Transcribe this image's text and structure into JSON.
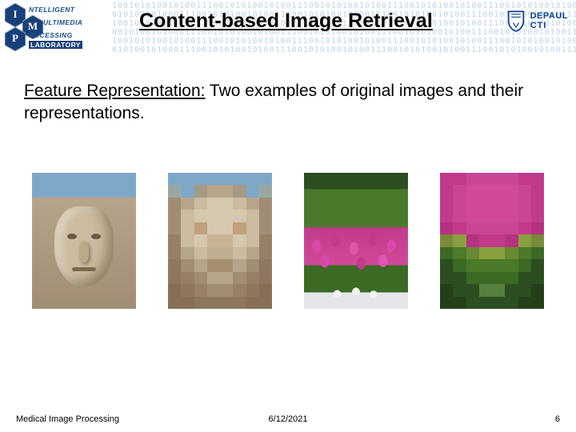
{
  "header": {
    "title": "Content-based Image Retrieval",
    "lab_logo": {
      "letters": [
        "I",
        "M",
        "P"
      ],
      "words": [
        "NTELLIGENT",
        "ULTIMEDIA",
        "ROCESSING"
      ],
      "suffix": "LABORATORY"
    },
    "depaul": {
      "line1": "DEPAUL",
      "line2": "CTI"
    }
  },
  "body": {
    "lead": "Feature Representation:",
    "rest": " Two examples of original images and their representations."
  },
  "images": {
    "items": [
      {
        "caption": ""
      },
      {
        "caption": ""
      },
      {
        "caption": ""
      },
      {
        "caption": ""
      }
    ]
  },
  "footer": {
    "left": "Medical Image Processing",
    "date": "6/12/2021",
    "page": "6"
  },
  "pixels": {
    "repr1": [
      "#7ea8c9",
      "#7ea8c9",
      "#7ea8c9",
      "#7ea8c9",
      "#7ea8c9",
      "#7ea8c9",
      "#7ea8c9",
      "#7ea8c9",
      "#9aa7a0",
      "#7ea8c9",
      "#a49a84",
      "#b7a58b",
      "#b7a58b",
      "#a49a84",
      "#7ea8c9",
      "#9aa7a0",
      "#a08d74",
      "#b7a58b",
      "#cbbba0",
      "#d6c8ae",
      "#d6c8ae",
      "#cbbba0",
      "#b7a58b",
      "#a08d74",
      "#a08d74",
      "#cbbba0",
      "#d6c8ae",
      "#d6c8ae",
      "#d6c8ae",
      "#d6c8ae",
      "#cbbba0",
      "#a08d74",
      "#a08d74",
      "#cbbba0",
      "#bfa07a",
      "#d6c8ae",
      "#d6c8ae",
      "#bfa07a",
      "#cbbba0",
      "#a08d74",
      "#968066",
      "#cbbba0",
      "#d6c8ae",
      "#c7b392",
      "#c7b392",
      "#d6c8ae",
      "#cbbba0",
      "#968066",
      "#968066",
      "#b7a58b",
      "#cbbba0",
      "#bfae90",
      "#bfae90",
      "#cbbba0",
      "#b7a58b",
      "#968066",
      "#8d785f",
      "#a08d74",
      "#b7a58b",
      "#a49071",
      "#a49071",
      "#b7a58b",
      "#a08d74",
      "#8d785f",
      "#8d785f",
      "#968066",
      "#a08d74",
      "#b7a58b",
      "#b7a58b",
      "#a08d74",
      "#968066",
      "#8d785f",
      "#857056",
      "#8d785f",
      "#968066",
      "#a08d74",
      "#a08d74",
      "#968066",
      "#8d785f",
      "#857056",
      "#857056",
      "#857056",
      "#8d785f",
      "#8d785f",
      "#8d785f",
      "#8d785f",
      "#857056",
      "#857056"
    ],
    "repr2": [
      "#c23a8a",
      "#c23a8a",
      "#c94696",
      "#c94696",
      "#c94696",
      "#c94696",
      "#c23a8a",
      "#c23a8a",
      "#c23a8a",
      "#c94696",
      "#d14a9a",
      "#d14a9a",
      "#d14a9a",
      "#d14a9a",
      "#c94696",
      "#c23a8a",
      "#c23a8a",
      "#c94696",
      "#d14a9a",
      "#d14a9a",
      "#d14a9a",
      "#d14a9a",
      "#c94696",
      "#c23a8a",
      "#c23a8a",
      "#c94696",
      "#d14a9a",
      "#d14a9a",
      "#d14a9a",
      "#d14a9a",
      "#c94696",
      "#c23a8a",
      "#b53280",
      "#c23a8a",
      "#c94696",
      "#c94696",
      "#c94696",
      "#c94696",
      "#c23a8a",
      "#b53280",
      "#7a8a3a",
      "#8aa040",
      "#b53280",
      "#c23a8a",
      "#c23a8a",
      "#b53280",
      "#8aa040",
      "#7a8a3a",
      "#3a6a24",
      "#4a7a2a",
      "#6a8a34",
      "#8aa040",
      "#8aa040",
      "#6a8a34",
      "#4a7a2a",
      "#3a6a24",
      "#2c4e20",
      "#3a6a24",
      "#4a7a2a",
      "#4a7a2a",
      "#4a7a2a",
      "#4a7a2a",
      "#3a6a24",
      "#2c4e20",
      "#2c4e20",
      "#2c4e20",
      "#3a6a24",
      "#3a6a24",
      "#3a6a24",
      "#3a6a24",
      "#2c4e20",
      "#2c4e20",
      "#24401a",
      "#2c4e20",
      "#2c4e20",
      "#588040",
      "#588040",
      "#2c4e20",
      "#2c4e20",
      "#24401a",
      "#24401a",
      "#24401a",
      "#2c4e20",
      "#2c4e20",
      "#2c4e20",
      "#2c4e20",
      "#24401a",
      "#24401a"
    ]
  }
}
